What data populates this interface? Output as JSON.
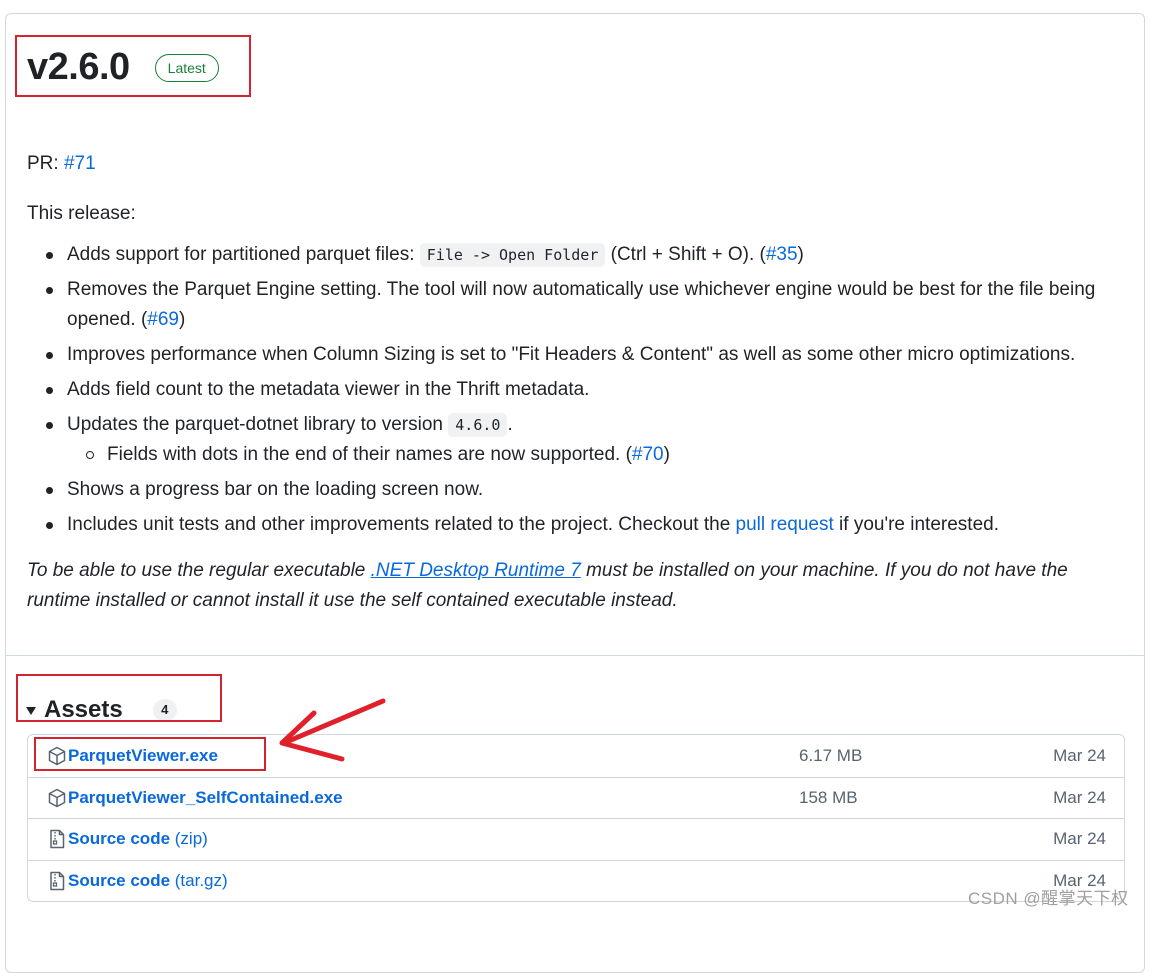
{
  "release": {
    "version": "v2.6.0",
    "badge": "Latest"
  },
  "body": {
    "pr_label": "PR: ",
    "pr_link": "#71",
    "intro": "This release:",
    "items": [
      {
        "pre": "Adds support for partitioned parquet files: ",
        "code": "File -> Open Folder",
        "post": " (Ctrl + Shift + O). (",
        "link": "#35",
        "end": ")"
      },
      {
        "pre": "Removes the Parquet Engine setting. The tool will now automatically use whichever engine would be best for the file being opened. (",
        "link": "#69",
        "end": ")"
      },
      {
        "pre": "Improves performance when Column Sizing is set to \"Fit Headers & Content\" as well as some other micro optimizations."
      },
      {
        "pre": "Adds field count to the metadata viewer in the Thrift metadata."
      },
      {
        "pre": "Updates the parquet-dotnet library to version ",
        "code": "4.6.0",
        "post": ".",
        "sub_pre": "Fields with dots in the end of their names are now supported. (",
        "sub_link": "#70",
        "sub_end": ")"
      },
      {
        "pre": "Shows a progress bar on the loading screen now."
      },
      {
        "pre": "Includes unit tests and other improvements related to the project. Checkout the ",
        "link": "pull request",
        "end": " if you're interested."
      }
    ],
    "note_pre": "To be able to use the regular executable ",
    "note_link": ".NET Desktop Runtime 7",
    "note_post": " must be installed on your machine. If you do not have the runtime installed or cannot install it use the self contained executable instead."
  },
  "assets": {
    "title": "Assets",
    "count": "4",
    "rows": [
      {
        "name": "ParquetViewer.exe",
        "suffix": "",
        "size": "6.17 MB",
        "date": "Mar 24",
        "icon": "package-icon"
      },
      {
        "name": "ParquetViewer_SelfContained.exe",
        "suffix": "",
        "size": "158 MB",
        "date": "Mar 24",
        "icon": "package-icon"
      },
      {
        "name": "Source code",
        "suffix": " (zip)",
        "size": "",
        "date": "Mar 24",
        "icon": "file-zip-icon"
      },
      {
        "name": "Source code",
        "suffix": " (tar.gz)",
        "size": "",
        "date": "Mar 24",
        "icon": "file-zip-icon"
      }
    ]
  },
  "watermark": "CSDN @醒掌天下权",
  "colors": {
    "link": "#0969da",
    "badge": "#1a7f37",
    "annotation": "#d1242f"
  }
}
